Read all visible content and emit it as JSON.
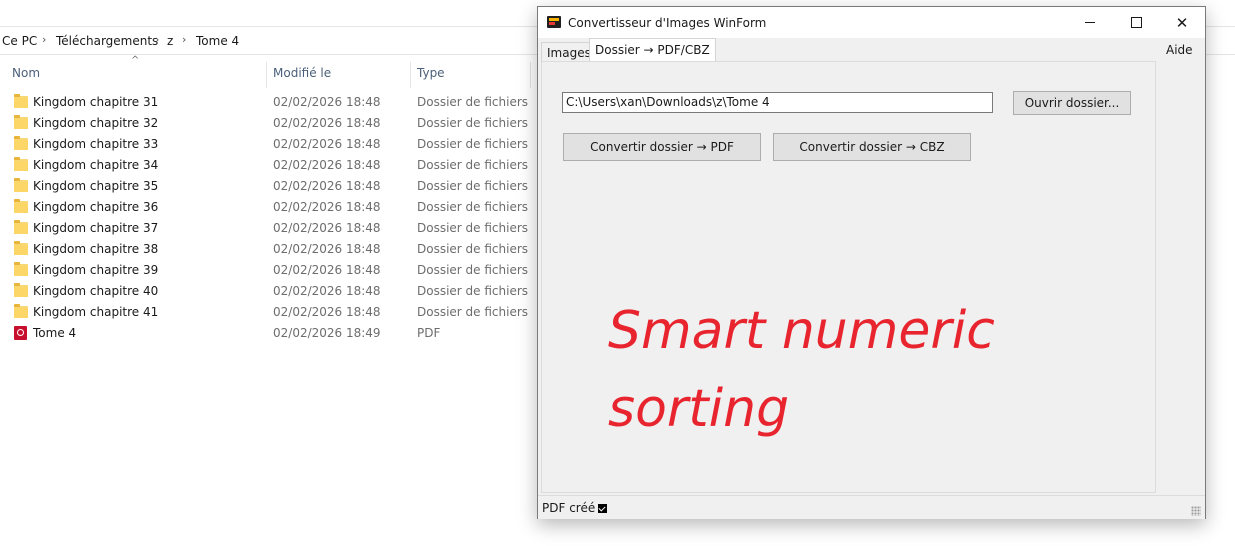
{
  "explorer": {
    "breadcrumb": [
      "Ce PC",
      "Téléchargements",
      "z",
      "Tome 4"
    ],
    "columns": {
      "name": "Nom",
      "modified": "Modifié le",
      "type": "Type"
    },
    "files": [
      {
        "name": "Kingdom chapitre 31",
        "date": "02/02/2026 18:48",
        "type": "Dossier de fichiers",
        "icon": "folder-icon"
      },
      {
        "name": "Kingdom chapitre 32",
        "date": "02/02/2026 18:48",
        "type": "Dossier de fichiers",
        "icon": "folder-icon"
      },
      {
        "name": "Kingdom chapitre 33",
        "date": "02/02/2026 18:48",
        "type": "Dossier de fichiers",
        "icon": "folder-icon"
      },
      {
        "name": "Kingdom chapitre 34",
        "date": "02/02/2026 18:48",
        "type": "Dossier de fichiers",
        "icon": "folder-icon"
      },
      {
        "name": "Kingdom chapitre 35",
        "date": "02/02/2026 18:48",
        "type": "Dossier de fichiers",
        "icon": "folder-icon"
      },
      {
        "name": "Kingdom chapitre 36",
        "date": "02/02/2026 18:48",
        "type": "Dossier de fichiers",
        "icon": "folder-icon"
      },
      {
        "name": "Kingdom chapitre 37",
        "date": "02/02/2026 18:48",
        "type": "Dossier de fichiers",
        "icon": "folder-icon"
      },
      {
        "name": "Kingdom chapitre 38",
        "date": "02/02/2026 18:48",
        "type": "Dossier de fichiers",
        "icon": "folder-icon"
      },
      {
        "name": "Kingdom chapitre 39",
        "date": "02/02/2026 18:48",
        "type": "Dossier de fichiers",
        "icon": "folder-icon"
      },
      {
        "name": "Kingdom chapitre 40",
        "date": "02/02/2026 18:48",
        "type": "Dossier de fichiers",
        "icon": "folder-icon"
      },
      {
        "name": "Kingdom chapitre 41",
        "date": "02/02/2026 18:48",
        "type": "Dossier de fichiers",
        "icon": "folder-icon"
      },
      {
        "name": "Tome 4",
        "date": "02/02/2026 18:49",
        "type": "PDF",
        "icon": "pdf-icon"
      }
    ]
  },
  "app": {
    "title": "Convertisseur d'Images WinForm",
    "tabs": [
      "Images",
      "Dossier → PDF/CBZ"
    ],
    "menu_help": "Aide",
    "folder_path": "C:\\Users\\xan\\Downloads\\z\\Tome 4",
    "open_folder_label": "Ouvrir dossier...",
    "convert_pdf_label": "Convertir dossier → PDF",
    "convert_cbz_label": "Convertir dossier → CBZ",
    "overlay_text": [
      "Smart numeric",
      "sorting"
    ],
    "overlay_color": "#e8252f",
    "status_text": "PDF créé"
  }
}
